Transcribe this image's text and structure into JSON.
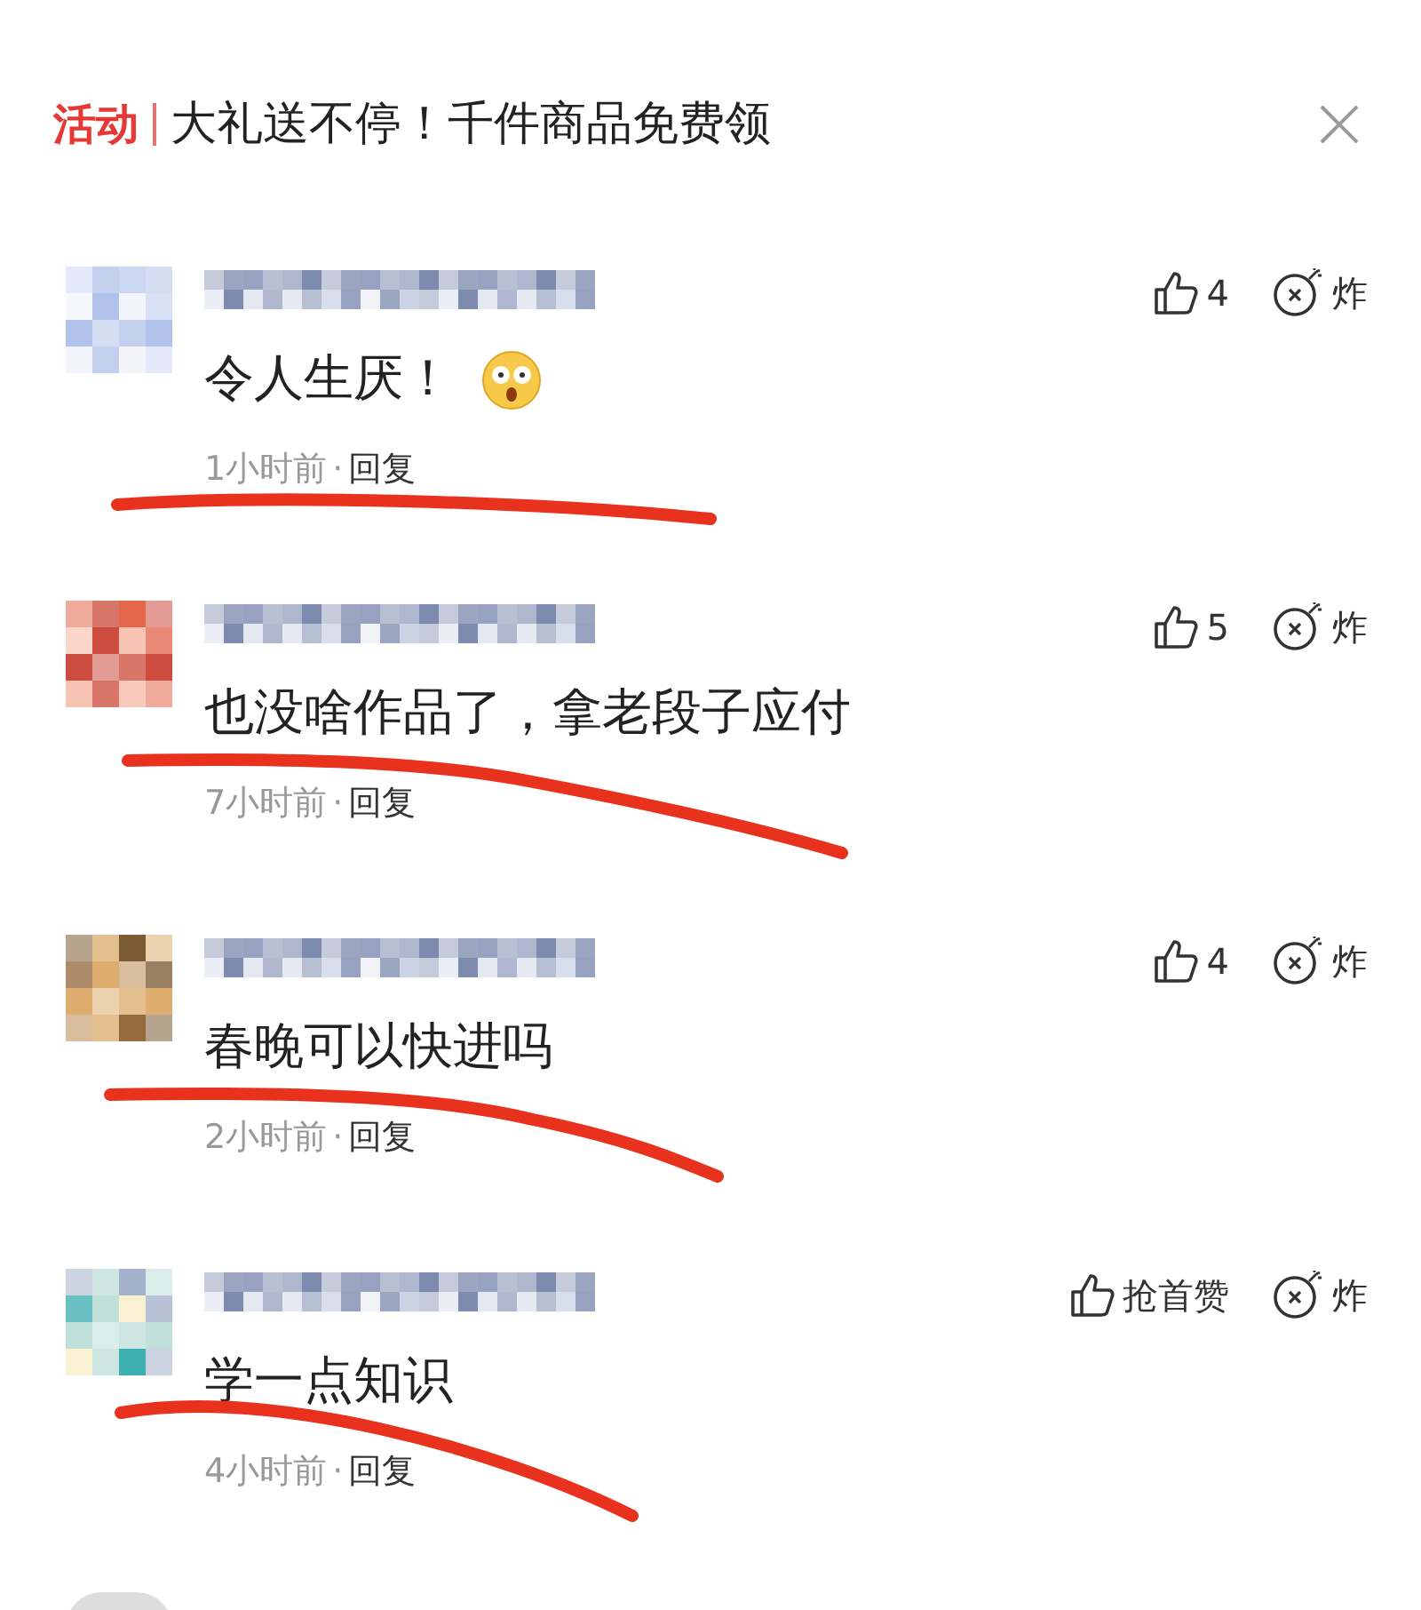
{
  "banner": {
    "tag": "活动",
    "title": "大礼送不停！千件商品免费领"
  },
  "comments": [
    {
      "content": "令人生厌！",
      "has_emoji": true,
      "time": "1小时前",
      "separator": "·",
      "reply": "回复",
      "likes": "4",
      "bomb": "炸"
    },
    {
      "content": "也没啥作品了，拿老段子应付",
      "has_emoji": false,
      "time": "7小时前",
      "separator": "·",
      "reply": "回复",
      "likes": "5",
      "bomb": "炸"
    },
    {
      "content": "春晚可以快进吗",
      "has_emoji": false,
      "time": "2小时前",
      "separator": "·",
      "reply": "回复",
      "likes": "4",
      "bomb": "炸"
    },
    {
      "content": "学一点知识",
      "has_emoji": false,
      "time": "4小时前",
      "separator": "·",
      "reply": "回复",
      "likes": "抢首赞",
      "bomb": "炸"
    }
  ]
}
